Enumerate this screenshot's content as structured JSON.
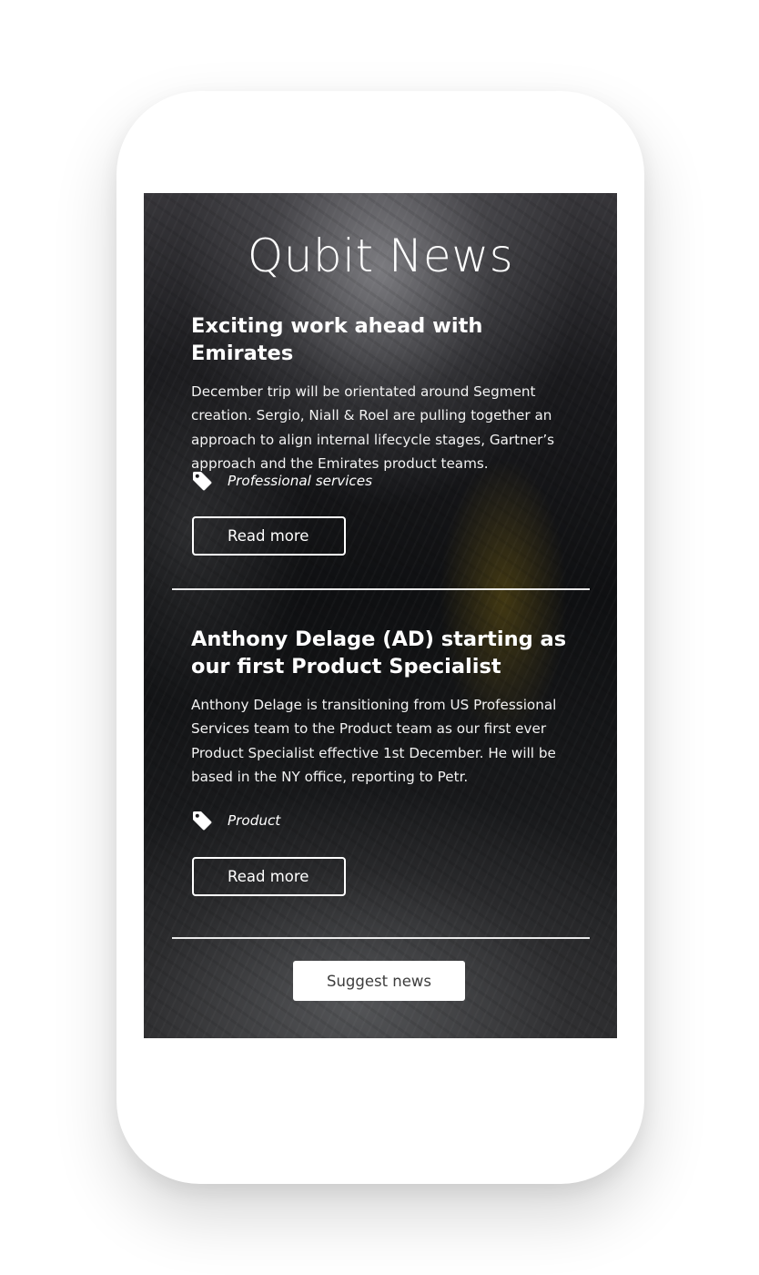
{
  "app": {
    "title": "Qubit News"
  },
  "articles": [
    {
      "headline": "Exciting work ahead with Emirates",
      "body": "December trip will be orientated around Segment creation. Sergio, Niall & Roel are pulling together an approach to align internal lifecycle stages, Gartner’s approach and the Emirates product teams.",
      "tag_icon": "tag-icon",
      "tag": "Professional services",
      "button_label": "Read more"
    },
    {
      "headline": "Anthony Delage (AD) starting as our first Product Specialist",
      "body": "Anthony Delage is transitioning from US Professional Services team to the Product team as our first ever Product Specialist effective 1st December. He will be based in the NY office, reporting to Petr.",
      "tag_icon": "tag-icon",
      "tag": "Product",
      "button_label": "Read more"
    }
  ],
  "footer": {
    "suggest_label": "Suggest news"
  }
}
